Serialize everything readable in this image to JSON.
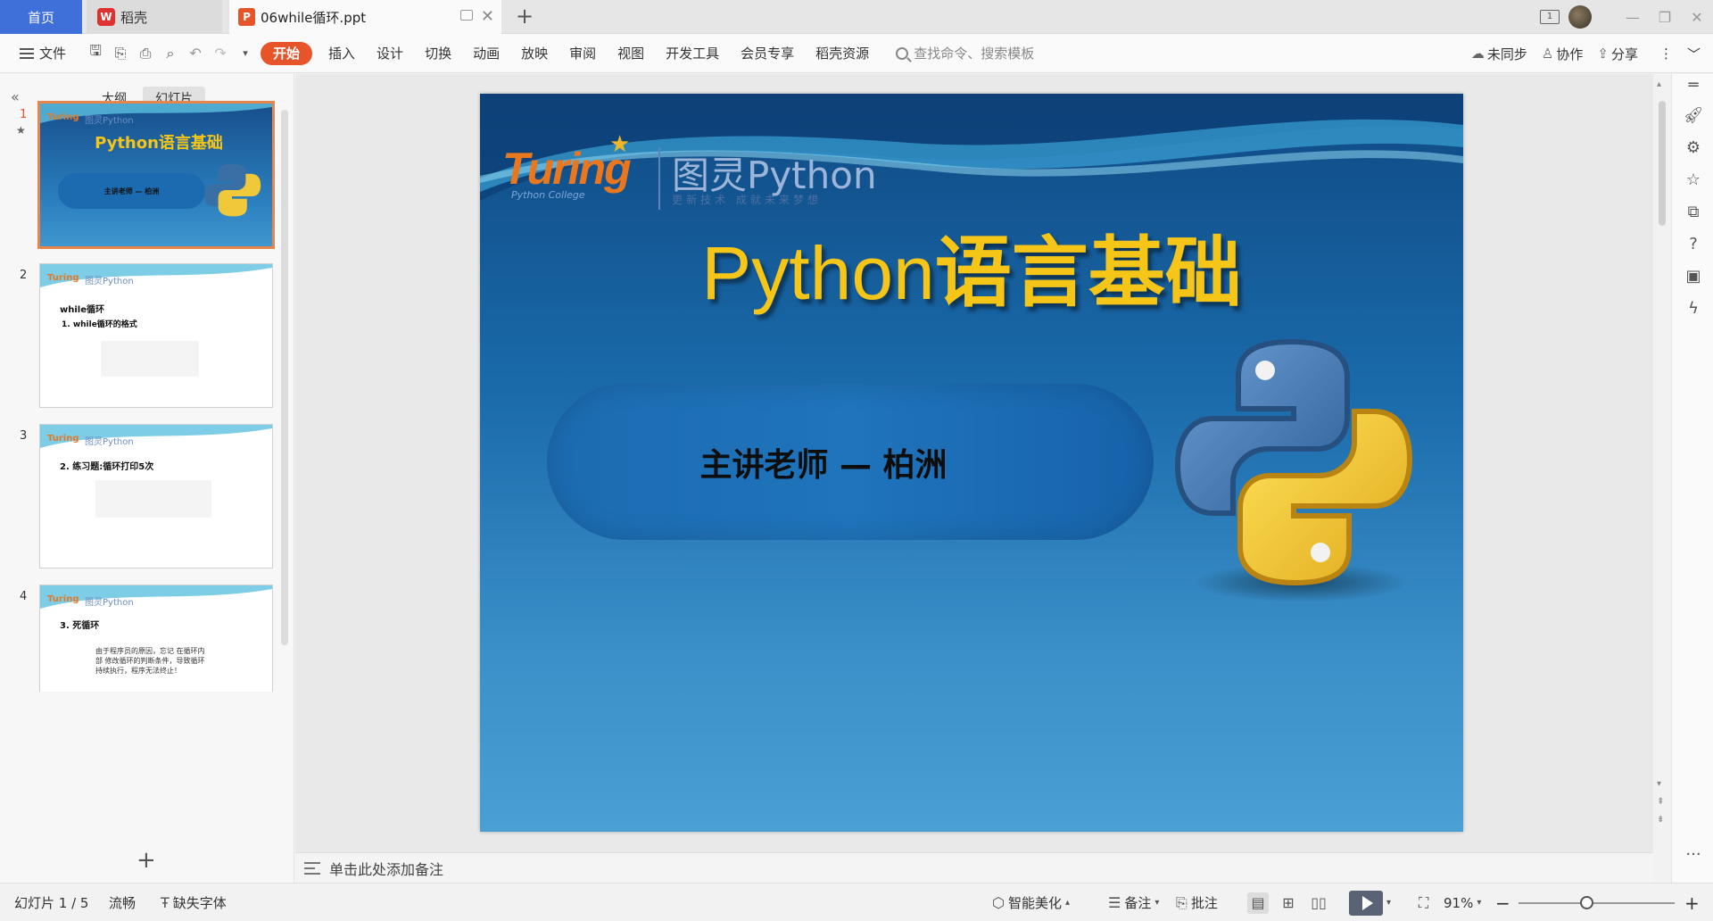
{
  "tabs": {
    "home": "首页",
    "docer": "稻壳",
    "document": "06while循环.ppt"
  },
  "ribbon": {
    "file_menu": "文件",
    "tabs": [
      "开始",
      "插入",
      "设计",
      "切换",
      "动画",
      "放映",
      "审阅",
      "视图",
      "开发工具",
      "会员专享",
      "稻壳资源"
    ],
    "search_placeholder": "查找命令、搜索模板",
    "sync": "未同步",
    "collab": "协作",
    "share": "分享"
  },
  "left_panel": {
    "view_outline": "大纲",
    "view_slides": "幻灯片",
    "thumbnails": [
      {
        "num": "1",
        "title": "Python语言基础",
        "subtitle": "主讲老师 — 柏洲",
        "logo": "Turing",
        "logo2": "图灵Python"
      },
      {
        "num": "2",
        "title": "while循环",
        "subtitle": "1. while循环的格式",
        "logo": "Turing",
        "logo2": "图灵Python"
      },
      {
        "num": "3",
        "title": "2. 练习题:循环打印5次",
        "logo": "Turing",
        "logo2": "图灵Python"
      },
      {
        "num": "4",
        "title": "3. 死循环",
        "body": "由于程序员的原因，忘记 在循环内部 修改循环的判断条件，导致循环持续执行，程序无法终止！",
        "logo": "Turing",
        "logo2": "图灵Python"
      }
    ]
  },
  "slide": {
    "logo_turing": "Turing",
    "logo_college": "Python College",
    "logo_tuling": "图灵Python",
    "logo_slogan": "更新技术 成就未来梦想",
    "title_latin": "Python",
    "title_cjk": "语言基础",
    "presenter": "主讲老师 — 柏洲"
  },
  "notes_placeholder": "单击此处添加备注",
  "statusbar": {
    "slide_counter": "幻灯片 1 / 5",
    "theme": "流畅",
    "missing_fonts": "缺失字体",
    "smart_beautify": "智能美化",
    "notes": "备注",
    "comments": "批注",
    "zoom": "91%"
  },
  "colors": {
    "accent": "#e8542a",
    "home_tab": "#3f6fd9",
    "slide_title": "#f5c518"
  }
}
